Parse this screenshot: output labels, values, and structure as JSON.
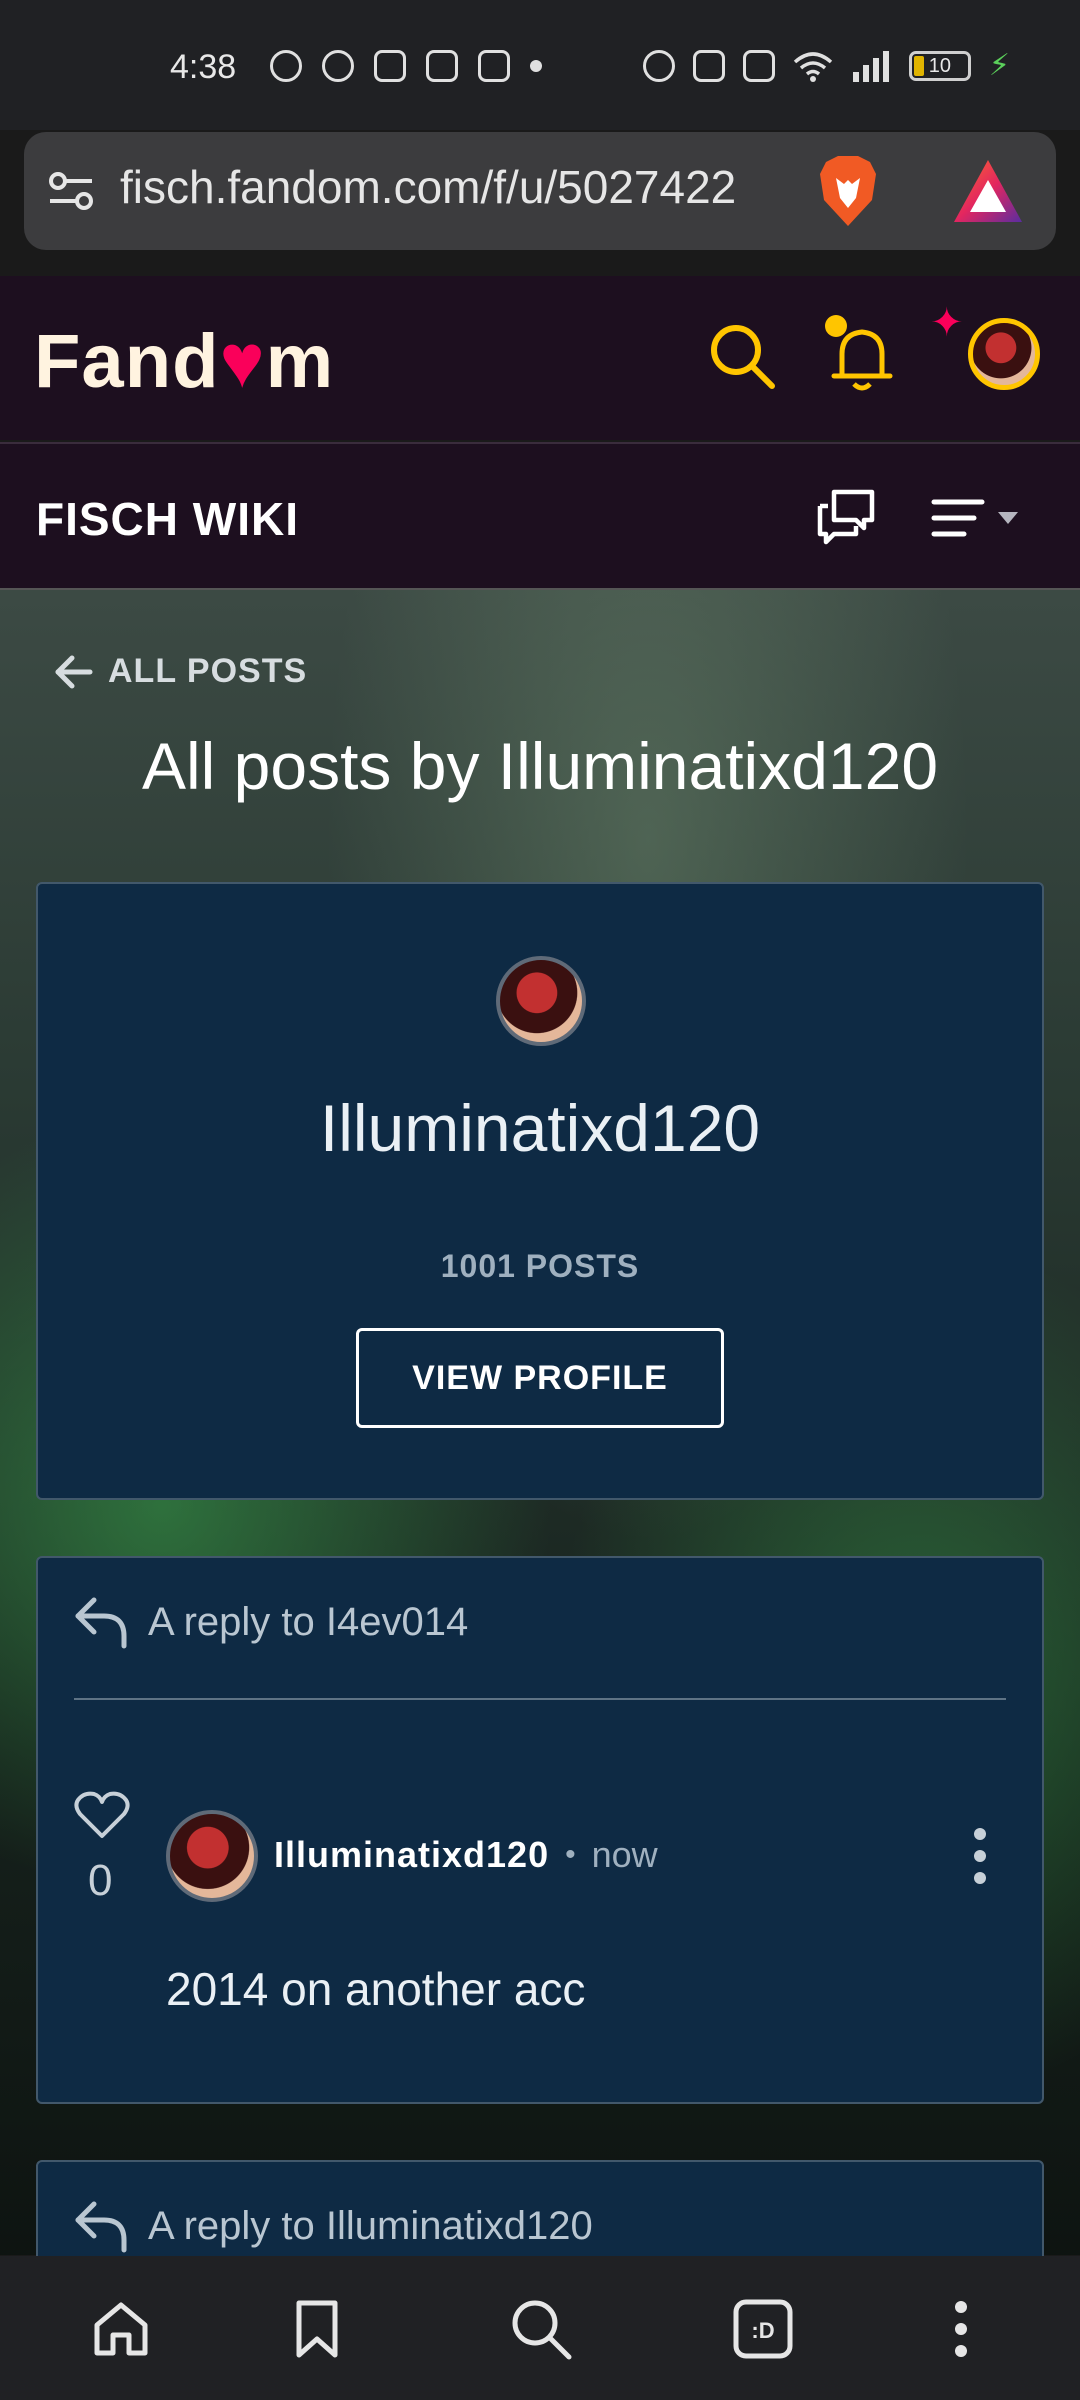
{
  "status_bar": {
    "time": "4:38",
    "battery_level": "10"
  },
  "browser": {
    "url": "fisch.fandom.com/f/u/5027422"
  },
  "fandom": {
    "logo_text_a": "Fand",
    "logo_text_b": "m",
    "wiki_title": "FISCH WIKI"
  },
  "page": {
    "back_label": "ALL POSTS",
    "title": "All posts by Illuminatixd120"
  },
  "profile": {
    "username": "Illuminatixd120",
    "post_count": "1001 POSTS",
    "view_profile_label": "VIEW PROFILE"
  },
  "posts": [
    {
      "reply_to": "A reply to I4ev014",
      "likes": "0",
      "author": "Illuminatixd120",
      "separator": "•",
      "time": "now",
      "body": "2014 on another acc"
    },
    {
      "reply_to": "A reply to Illuminatixd120"
    }
  ],
  "colors": {
    "fandom_pink": "#fa005a",
    "fandom_yellow": "#ffc500",
    "header_bg": "#1d0f1f",
    "card_bg": "#0e2a44"
  },
  "icons": [
    "tune-icon",
    "brave-lion-icon",
    "brave-rewards-icon",
    "search-icon",
    "bell-icon",
    "discussions-icon",
    "menu-icon",
    "back-arrow-icon",
    "reply-icon",
    "heart-icon",
    "kebab-icon",
    "home-icon",
    "bookmark-icon",
    "tab-switcher-icon"
  ]
}
